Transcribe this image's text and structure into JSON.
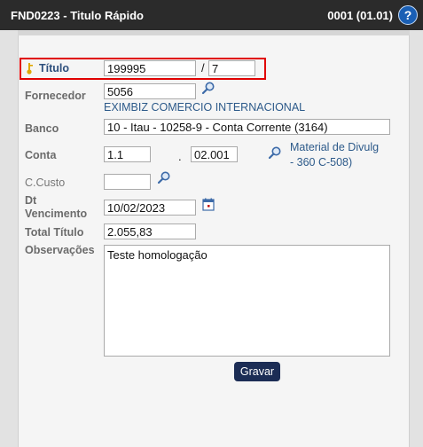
{
  "window": {
    "title": "FND0223 - Titulo Rápido",
    "code": "0001 (01.01)",
    "help_label": "?"
  },
  "form": {
    "titulo": {
      "label": "Título",
      "value": "199995",
      "sep": "/",
      "parcela": "7"
    },
    "fornecedor": {
      "label": "Fornecedor",
      "value": "5056",
      "name": "EXIMBIZ COMERCIO INTERNACIONAL"
    },
    "banco": {
      "label": "Banco",
      "value": "10 - Itau - 10258-9 - Conta Corrente (3164)"
    },
    "conta": {
      "label": "Conta",
      "value1": "1.1",
      "sep": ".",
      "value2": "02.001",
      "desc_line1": "Material de Divulg",
      "desc_line2": "- 360 C-508)"
    },
    "ccusto": {
      "label": "C.Custo",
      "value": ""
    },
    "vencimento": {
      "label_line1": "Dt",
      "label_line2": "Vencimento",
      "value": "10/02/2023"
    },
    "total": {
      "label": "Total Título",
      "value": "2.055,83"
    },
    "observacoes": {
      "label": "Observações",
      "value": "Teste homologação"
    }
  },
  "actions": {
    "save_label": "Gravar"
  },
  "colors": {
    "titlebar": "#2b2b2b",
    "highlight": "#e00000",
    "button": "#1c2d55",
    "link": "#2d5a8a"
  }
}
